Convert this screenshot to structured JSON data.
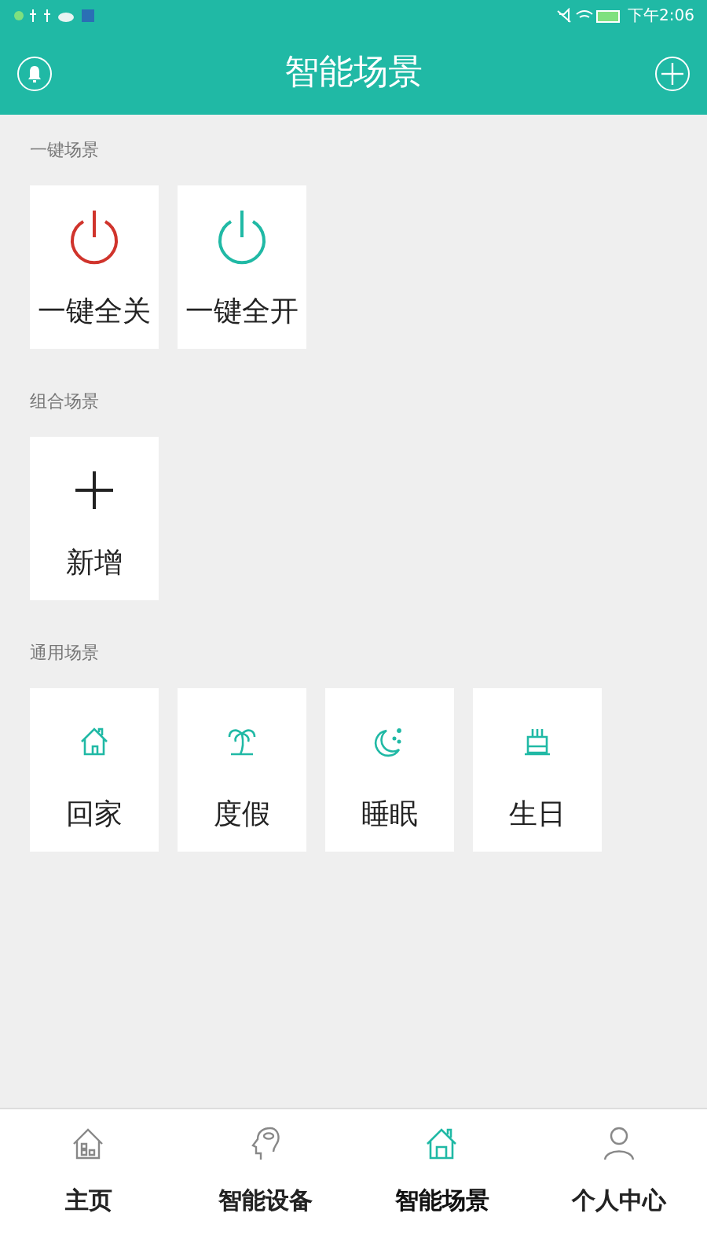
{
  "status_bar": {
    "time": "下午2:06"
  },
  "header": {
    "title": "智能场景"
  },
  "sections": [
    {
      "title": "一键场景",
      "tiles": [
        {
          "kind": "power-off",
          "label": "一键全关"
        },
        {
          "kind": "power-on",
          "label": "一键全开"
        }
      ]
    },
    {
      "title": "组合场景",
      "tiles": [
        {
          "kind": "add",
          "label": "新增"
        }
      ]
    },
    {
      "title": "通用场景",
      "tiles": [
        {
          "kind": "home",
          "label": "回家"
        },
        {
          "kind": "palm",
          "label": "度假"
        },
        {
          "kind": "moon",
          "label": "睡眠"
        },
        {
          "kind": "cake",
          "label": "生日"
        }
      ]
    }
  ],
  "nav": [
    {
      "kind": "home",
      "label": "主页",
      "selected": false
    },
    {
      "kind": "brain",
      "label": "智能设备",
      "selected": false
    },
    {
      "kind": "scene",
      "label": "智能场景",
      "selected": true
    },
    {
      "kind": "person",
      "label": "个人中心",
      "selected": false
    }
  ]
}
